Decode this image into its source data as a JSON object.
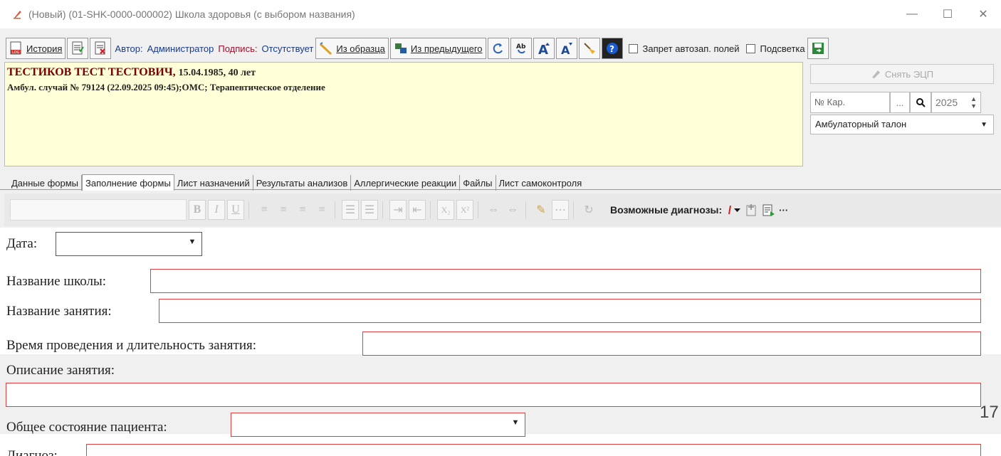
{
  "window": {
    "title": "(Новый) (01-SHK-0000-000002) Школа здоровья (с выбором названия)",
    "minimize": "—",
    "maximize": "☐",
    "close": "✕"
  },
  "toolbar": {
    "history_label": "История",
    "author_label": "Автор:",
    "author_value": "Администратор",
    "signature_label": "Подпись:",
    "signature_value": "Отсутствует",
    "from_sample_label": "Из образца",
    "from_previous_label": "Из предыдущего",
    "ban_autofill_label": "Запрет автозап. полей",
    "highlight_label": "Подсветка"
  },
  "patient": {
    "name": "ТЕСТИКОВ ТЕСТ ТЕСТОВИЧ,",
    "dob_age": "15.04.1985, 40 лет",
    "case": "Амбул. случай  № 79124 (22.09.2025 09:45);ОМС; Терапевтическое отделение"
  },
  "side": {
    "remove_ecp_label": "Снять ЭЦП",
    "card_placeholder": "№ Кар.",
    "card_dots": "...",
    "year": "2025",
    "doc_type": "Амбулаторный талон"
  },
  "tabs": [
    {
      "label": "Данные формы"
    },
    {
      "label": "Заполнение формы"
    },
    {
      "label": "Лист назначений"
    },
    {
      "label": "Результаты анализов"
    },
    {
      "label": "Аллергические реакции"
    },
    {
      "label": "Файлы"
    },
    {
      "label": "Лист самоконтроля"
    }
  ],
  "editor": {
    "bold": "B",
    "italic": "I",
    "underline": "U",
    "subscript": "X₂",
    "superscript": "X²",
    "possible_diagnoses_label": "Возможные диагнозы:",
    "more": "···"
  },
  "form": {
    "date_label": "Дата:",
    "school_label": "Название школы:",
    "lesson_label": "Название занятия:",
    "time_label": "Время проведения и длительность занятия:",
    "description_label": "Описание занятия:",
    "condition_label": "Общее состояние пациента:",
    "diagnosis_label": "Диагноз:"
  },
  "page_number": "17",
  "colors": {
    "accent_red": "#a0102a",
    "accent_blue": "#1a3a8a",
    "required_border": "#e04040",
    "patient_bg": "#ffffd8"
  }
}
